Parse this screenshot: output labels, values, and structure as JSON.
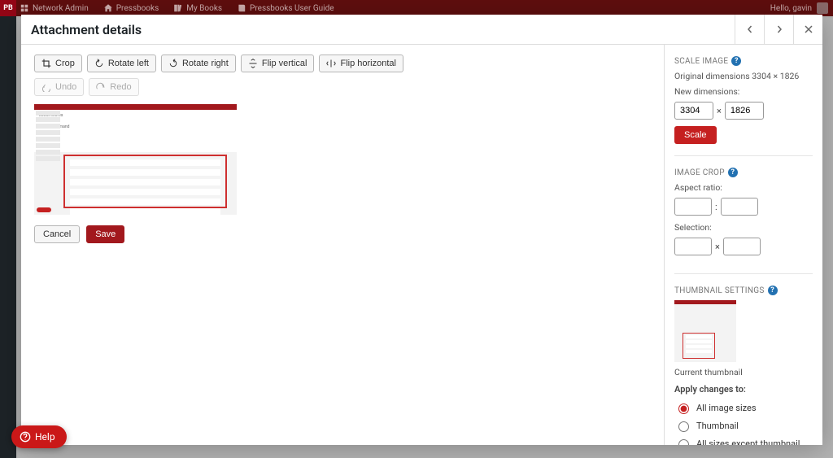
{
  "adminbar": {
    "logo_text": "PB",
    "items": [
      "Network Admin",
      "Pressbooks",
      "My Books",
      "Pressbooks User Guide"
    ],
    "greeting": "Hello, gavin"
  },
  "modal": {
    "title": "Attachment details"
  },
  "toolbar": {
    "crop": "Crop",
    "rotate_left": "Rotate left",
    "rotate_right": "Rotate right",
    "flip_v": "Flip vertical",
    "flip_h": "Flip horizontal",
    "undo": "Undo",
    "redo": "Redo"
  },
  "actions": {
    "cancel": "Cancel",
    "save": "Save"
  },
  "scale": {
    "title": "SCALE IMAGE",
    "original": "Original dimensions 3304 × 1826",
    "new_dim_label": "New dimensions:",
    "w": "3304",
    "h": "1826",
    "times": "×",
    "button": "Scale"
  },
  "crop": {
    "title": "IMAGE CROP",
    "aspect_label": "Aspect ratio:",
    "aspect_sep": ":",
    "selection_label": "Selection:",
    "sel_sep": "×"
  },
  "thumb": {
    "title": "THUMBNAIL SETTINGS",
    "current": "Current thumbnail",
    "apply_label": "Apply changes to:",
    "options": {
      "all": "All image sizes",
      "thumb": "Thumbnail",
      "except": "All sizes except thumbnail"
    }
  },
  "help": "Help"
}
